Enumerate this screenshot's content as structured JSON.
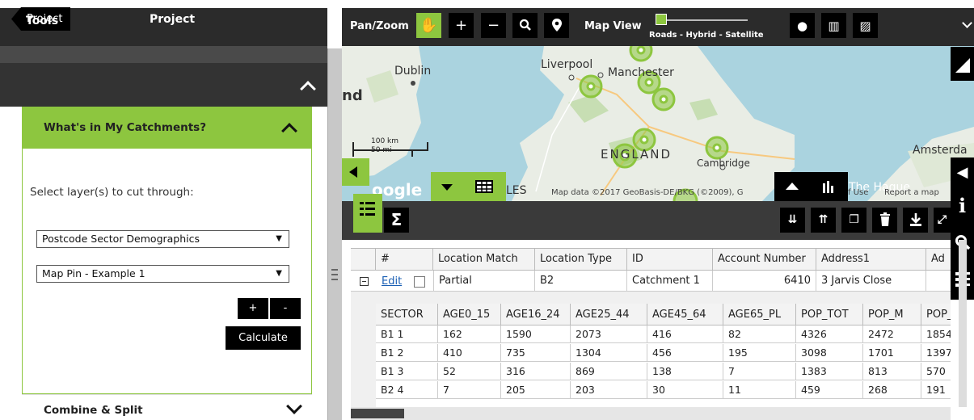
{
  "left_panel": {
    "back_label": "Project",
    "title": "Project",
    "tools_label": "Tools",
    "catchments_title": "What's in My Catchments?",
    "select_label": "Select layer(s) to cut through:",
    "layer1": "Postcode Sector Demographics",
    "layer2": "Map Pin - Example 1",
    "plus_label": "+",
    "minus_label": "-",
    "calculate_label": "Calculate",
    "combine_label": "Combine & Split"
  },
  "toolbar": {
    "panzoom_label": "Pan/Zoom",
    "mapview_label": "Map View",
    "mapview_caption": "Roads - Hybrid - Satellite",
    "icons": [
      "hand-icon",
      "zoom-in-icon",
      "zoom-out-icon",
      "search-icon",
      "pin-icon",
      "street-view-icon",
      "map-fold-icon",
      "map-off-icon"
    ],
    "accent": "#8dc63f"
  },
  "map": {
    "places": {
      "dublin": "Dublin",
      "liverpool": "Liverpool",
      "manchester": "Manchester",
      "england": "ENGLAND",
      "cambridge": "Cambridge",
      "amsterdam": "Amsterda",
      "hague": "The Hague",
      "edge_nd": "nd"
    },
    "scale_km": "100 km",
    "scale_mi": "50 mi",
    "google": "oogle",
    "les": "LES",
    "attribution": "Map data ©2017 GeoBasis-DE/BKG (©2009), G",
    "terms": "f Use",
    "report": "Report a map"
  },
  "grid": {
    "sigma": "Σ",
    "columns": [
      "#",
      "Location Match",
      "Location Type",
      "ID",
      "Account Number",
      "Address1",
      "Ad"
    ],
    "row": {
      "edit": "Edit",
      "location_match": "Partial",
      "location_type": "B2",
      "id": "Catchment 1",
      "account_number": "6410",
      "address1": "3 Jarvis Close"
    },
    "sub_columns": [
      "SECTOR",
      "AGE0_15",
      "AGE16_24",
      "AGE25_44",
      "AGE45_64",
      "AGE65_PL",
      "POP_TOT",
      "POP_M",
      "POP_"
    ],
    "sub_rows": [
      [
        "B1 1",
        "162",
        "1590",
        "2073",
        "416",
        "82",
        "4326",
        "2472",
        "1854"
      ],
      [
        "B1 2",
        "410",
        "735",
        "1304",
        "456",
        "195",
        "3098",
        "1701",
        "1397"
      ],
      [
        "B1 3",
        "52",
        "316",
        "869",
        "138",
        "7",
        "1383",
        "813",
        "570"
      ],
      [
        "B2 4",
        "7",
        "205",
        "203",
        "30",
        "11",
        "459",
        "268",
        "191"
      ]
    ]
  }
}
